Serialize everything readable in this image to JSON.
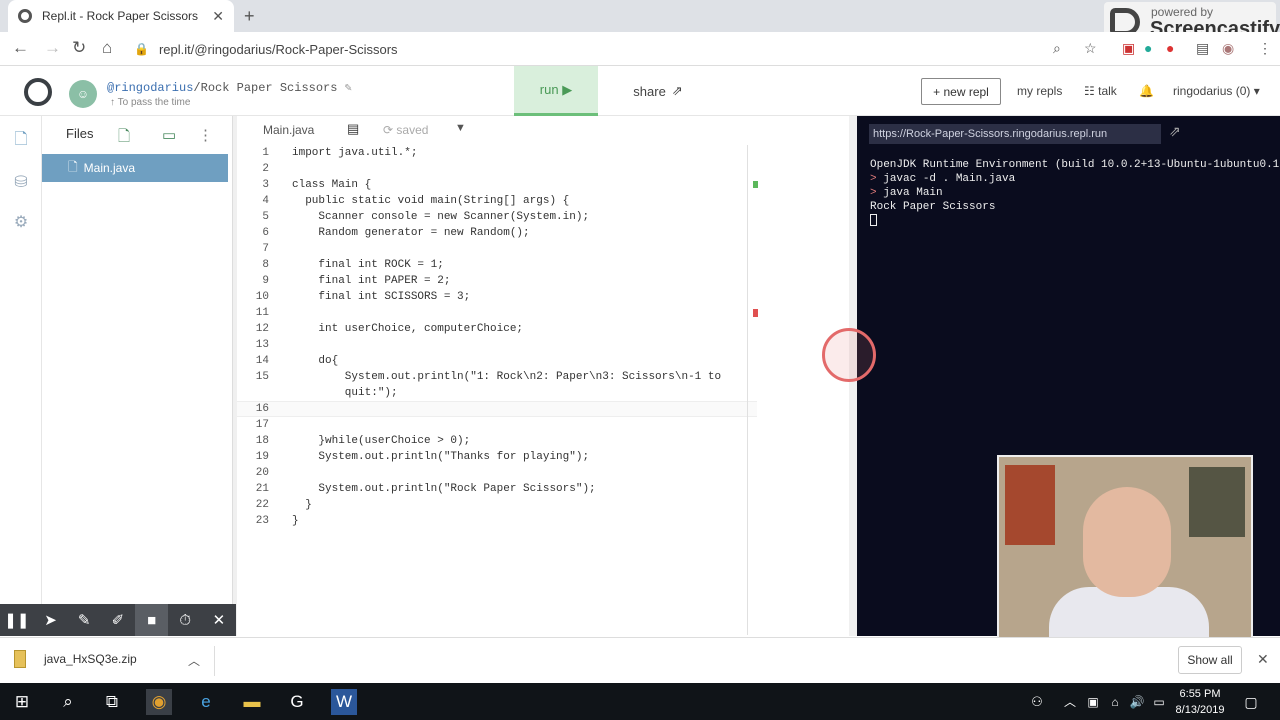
{
  "browser": {
    "tab_title": "Repl.it - Rock Paper Scissors",
    "url": "repl.it/@ringodarius/Rock-Paper-Scissors",
    "screencastify_small": "powered by",
    "screencastify_big": "Screencastify"
  },
  "header": {
    "owner": "@ringodarius",
    "repl_name": "/Rock Paper Scissors",
    "description": "To pass the time",
    "run_label": "run ▶",
    "share_label": "share",
    "new_repl_label": "+ new repl",
    "my_repls_label": "my repls",
    "talk_label": "talk",
    "user_label": "ringodarius (0)"
  },
  "files": {
    "title": "Files",
    "items": [
      {
        "label": "Main.java"
      }
    ]
  },
  "editor": {
    "tab_label": "Main.java",
    "saved_label": "saved",
    "lines": [
      {
        "n": "1",
        "text": "import java.util.*;"
      },
      {
        "n": "2",
        "text": ""
      },
      {
        "n": "3",
        "text": "class Main {"
      },
      {
        "n": "4",
        "text": "  public static void main(String[] args) {"
      },
      {
        "n": "5",
        "text": "    Scanner console = new Scanner(System.in);"
      },
      {
        "n": "6",
        "text": "    Random generator = new Random();"
      },
      {
        "n": "7",
        "text": ""
      },
      {
        "n": "8",
        "text": "    final int ROCK = 1;"
      },
      {
        "n": "9",
        "text": "    final int PAPER = 2;"
      },
      {
        "n": "10",
        "text": "    final int SCISSORS = 3;"
      },
      {
        "n": "11",
        "text": ""
      },
      {
        "n": "12",
        "text": "    int userChoice, computerChoice;"
      },
      {
        "n": "13",
        "text": ""
      },
      {
        "n": "14",
        "text": "    do{"
      },
      {
        "n": "15",
        "text": "        System.out.println(\"1: Rock\\n2: Paper\\n3: Scissors\\n-1 to"
      },
      {
        "n": "",
        "text": "        quit:\");"
      },
      {
        "n": "16",
        "text": ""
      },
      {
        "n": "17",
        "text": ""
      },
      {
        "n": "18",
        "text": "    }while(userChoice > 0);"
      },
      {
        "n": "19",
        "text": "    System.out.println(\"Thanks for playing\");"
      },
      {
        "n": "20",
        "text": ""
      },
      {
        "n": "21",
        "text": "    System.out.println(\"Rock Paper Scissors\");"
      },
      {
        "n": "22",
        "text": "  }"
      },
      {
        "n": "23",
        "text": "}"
      }
    ]
  },
  "terminal": {
    "url": "https://Rock-Paper-Scissors.ringodarius.repl.run",
    "line1": "OpenJDK Runtime Environment (build 10.0.2+13-Ubuntu-1ubuntu0.1",
    "line2": "javac -d . Main.java",
    "line3": "java Main",
    "line4": "Rock Paper Scissors",
    "prompt": ">"
  },
  "downloads": {
    "file_name": "java_HxSQ3e.zip",
    "show_all_label": "Show all"
  },
  "taskbar": {
    "time": "6:55 PM",
    "date": "8/13/2019"
  },
  "colors": {
    "terminal_bg": "#0a0c1e",
    "file_selected": "#6f9fc1",
    "run_bg": "#d9efdc"
  }
}
